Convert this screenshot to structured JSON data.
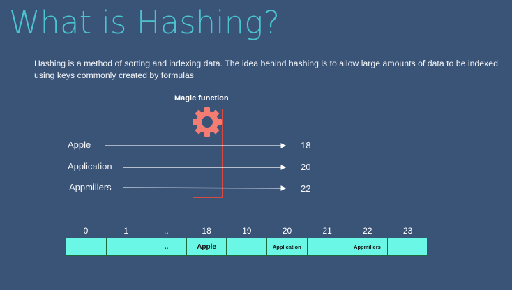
{
  "title": "What is Hashing?",
  "description": "Hashing is a method of sorting and indexing data. The idea behind hashing is to allow large amounts of data to be indexed using keys commonly created by formulas",
  "diagram": {
    "function_label": "Magic function",
    "mappings": [
      {
        "key": "Apple",
        "hash": "18"
      },
      {
        "key": "Application",
        "hash": "20"
      },
      {
        "key": "Appmillers",
        "hash": "22"
      }
    ]
  },
  "table": {
    "indices": [
      "0",
      "1",
      "..",
      "18",
      "19",
      "20",
      "21",
      "22",
      "23"
    ],
    "cells": [
      "",
      "",
      "..",
      "Apple",
      "",
      "Application",
      "",
      "Appmillers",
      ""
    ]
  },
  "colors": {
    "background": "#3a5478",
    "title": "#4cc4cf",
    "gear": "#f47c72",
    "box": "#d9493f",
    "cell": "#6af7e6"
  }
}
